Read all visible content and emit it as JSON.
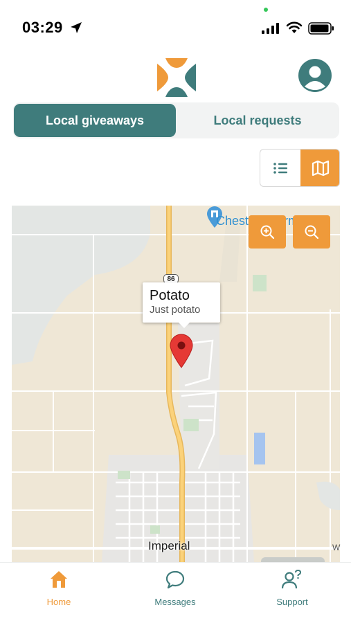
{
  "status_bar": {
    "time": "03:29"
  },
  "header": {
    "logo_icon": "app-logo-icon",
    "profile_icon": "profile-icon"
  },
  "tabs": [
    {
      "label": "Local giveaways",
      "active": true
    },
    {
      "label": "Local requests",
      "active": false
    }
  ],
  "view_toggle": {
    "list_icon": "list-view-icon",
    "map_icon": "map-view-icon",
    "selected": "map"
  },
  "map": {
    "poi_label": "Chestnut Farm",
    "highway_number": "86",
    "town_label": "Imperial",
    "edge_label": "W",
    "info_window": {
      "title": "Potato",
      "subtitle": "Just potato"
    }
  },
  "bottom_nav": [
    {
      "label": "Home",
      "icon": "home-icon",
      "active": true
    },
    {
      "label": "Messages",
      "icon": "chat-bubble-icon",
      "active": false
    },
    {
      "label": "Support",
      "icon": "support-person-icon",
      "active": false
    }
  ],
  "colors": {
    "teal": "#3f7c7c",
    "orange": "#ef9a3a"
  }
}
